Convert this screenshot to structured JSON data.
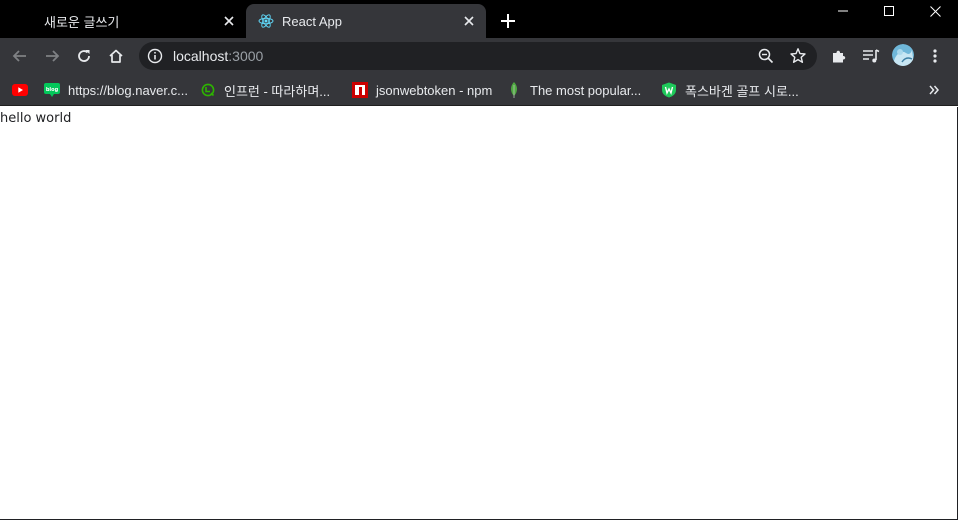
{
  "tabs": [
    {
      "title": "새로운 글쓰기",
      "active": false
    },
    {
      "title": "React App",
      "active": true
    }
  ],
  "toolbar": {
    "url_host": "localhost",
    "url_port": ":3000"
  },
  "bookmarks": [
    {
      "label": "",
      "icon": "youtube-icon",
      "color": "#ff0000"
    },
    {
      "label": "https://blog.naver.c...",
      "icon": "naver-blog-icon",
      "color": "#03c75a"
    },
    {
      "label": "인프런 - 따라하며...",
      "icon": "inflearn-icon",
      "color": "#2db400"
    },
    {
      "label": "jsonwebtoken - npm",
      "icon": "npm-icon",
      "color": "#cb0000"
    },
    {
      "label": "The most popular...",
      "icon": "mongodb-leaf-icon",
      "color": "#4faa41"
    },
    {
      "label": "폭스바겐 골프 시로...",
      "icon": "shield-icon",
      "color": "#1ec95a"
    }
  ],
  "page": {
    "body_text": "hello world"
  },
  "colors": {
    "titlebar": "#000000",
    "toolbar": "#35363a",
    "omnibox": "#202124",
    "icon": "#e8eaed",
    "react_blue": "#61dafb"
  }
}
